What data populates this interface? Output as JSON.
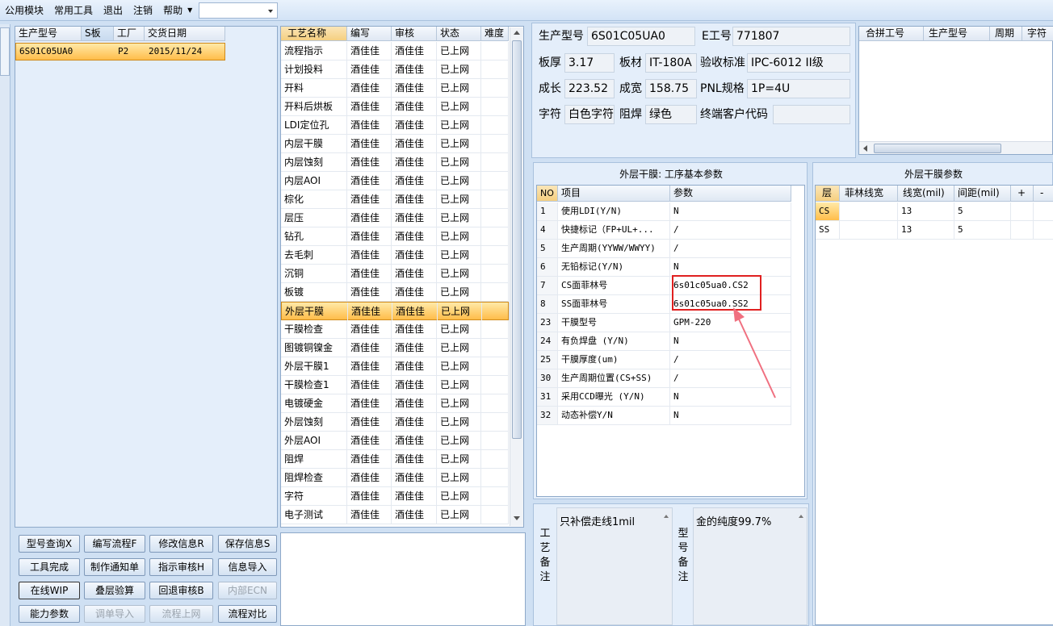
{
  "menu": {
    "items": [
      "公用模块",
      "常用工具",
      "退出",
      "注销",
      "帮助"
    ],
    "combo_value": ""
  },
  "left_grid": {
    "columns": [
      "生产型号",
      "S板",
      "工厂",
      "交货日期"
    ],
    "rows": [
      [
        "6S01C05UA0",
        "",
        "P2",
        "2015/11/24"
      ]
    ]
  },
  "process_grid": {
    "columns": [
      "工艺名称",
      "编写",
      "审核",
      "状态",
      "难度"
    ],
    "selected_index": 14,
    "rows": [
      [
        "流程指示",
        "酒佳佳",
        "酒佳佳",
        "已上网",
        ""
      ],
      [
        "计划投料",
        "酒佳佳",
        "酒佳佳",
        "已上网",
        ""
      ],
      [
        "开料",
        "酒佳佳",
        "酒佳佳",
        "已上网",
        ""
      ],
      [
        "开料后烘板",
        "酒佳佳",
        "酒佳佳",
        "已上网",
        ""
      ],
      [
        "LDI定位孔",
        "酒佳佳",
        "酒佳佳",
        "已上网",
        ""
      ],
      [
        "内层干膜",
        "酒佳佳",
        "酒佳佳",
        "已上网",
        ""
      ],
      [
        "内层蚀刻",
        "酒佳佳",
        "酒佳佳",
        "已上网",
        ""
      ],
      [
        "内层AOI",
        "酒佳佳",
        "酒佳佳",
        "已上网",
        ""
      ],
      [
        "棕化",
        "酒佳佳",
        "酒佳佳",
        "已上网",
        ""
      ],
      [
        "层压",
        "酒佳佳",
        "酒佳佳",
        "已上网",
        ""
      ],
      [
        "钻孔",
        "酒佳佳",
        "酒佳佳",
        "已上网",
        ""
      ],
      [
        "去毛刺",
        "酒佳佳",
        "酒佳佳",
        "已上网",
        ""
      ],
      [
        "沉铜",
        "酒佳佳",
        "酒佳佳",
        "已上网",
        ""
      ],
      [
        "板镀",
        "酒佳佳",
        "酒佳佳",
        "已上网",
        ""
      ],
      [
        "外层干膜",
        "酒佳佳",
        "酒佳佳",
        "已上网",
        ""
      ],
      [
        "干膜检查",
        "酒佳佳",
        "酒佳佳",
        "已上网",
        ""
      ],
      [
        "图镀铜镍金",
        "酒佳佳",
        "酒佳佳",
        "已上网",
        ""
      ],
      [
        "外层干膜1",
        "酒佳佳",
        "酒佳佳",
        "已上网",
        ""
      ],
      [
        "干膜检查1",
        "酒佳佳",
        "酒佳佳",
        "已上网",
        ""
      ],
      [
        "电镀硬金",
        "酒佳佳",
        "酒佳佳",
        "已上网",
        ""
      ],
      [
        "外层蚀刻",
        "酒佳佳",
        "酒佳佳",
        "已上网",
        ""
      ],
      [
        "外层AOI",
        "酒佳佳",
        "酒佳佳",
        "已上网",
        ""
      ],
      [
        "阻焊",
        "酒佳佳",
        "酒佳佳",
        "已上网",
        ""
      ],
      [
        "阻焊检查",
        "酒佳佳",
        "酒佳佳",
        "已上网",
        ""
      ],
      [
        "字符",
        "酒佳佳",
        "酒佳佳",
        "已上网",
        ""
      ],
      [
        "电子测试",
        "酒佳佳",
        "酒佳佳",
        "已上网",
        ""
      ]
    ]
  },
  "buttons": [
    [
      "型号查询X",
      "编写流程F",
      "修改信息R",
      "保存信息S"
    ],
    [
      "工具完成",
      "制作通知单",
      "指示审核H",
      "信息导入"
    ],
    [
      "在线WIP",
      "叠层验算",
      "回退审核B",
      "内部ECN"
    ],
    [
      "能力参数",
      "调单导入",
      "流程上网",
      "流程对比"
    ]
  ],
  "info": {
    "model_label": "生产型号",
    "model": "6S01C05UA0",
    "e_label": "E工号",
    "e_no": "771807",
    "thick_label": "板厚",
    "thick": "3.17",
    "mat_label": "板材",
    "mat": "IT-180A",
    "std_label": "验收标准",
    "std": "IPC-6012 II级",
    "len_label": "成长",
    "len": "223.52",
    "wid_label": "成宽",
    "wid": "158.75",
    "pnl_label": "PNL规格",
    "pnl": "1P=4U",
    "char_label": "字符",
    "char": "白色字符",
    "mask_label": "阻焊",
    "mask": "绿色",
    "cust_label": "终端客户代码",
    "cust": ""
  },
  "combine_grid": {
    "columns": [
      "合拼工号",
      "生产型号",
      "周期",
      "字符"
    ]
  },
  "param_panel": {
    "title": "外层干膜: 工序基本参数",
    "columns": [
      "NO",
      "项目",
      "参数"
    ],
    "rows": [
      [
        "1",
        "使用LDI(Y/N)",
        "N"
      ],
      [
        "4",
        "快捷标记（FP+UL+...",
        "/"
      ],
      [
        "5",
        "生产周期(YYWW/WWYY)",
        "/"
      ],
      [
        "6",
        "无铅标记(Y/N)",
        "N"
      ],
      [
        "7",
        "CS面菲林号",
        "6s01c05ua0.CS2"
      ],
      [
        "8",
        "SS面菲林号",
        "6s01c05ua0.SS2"
      ],
      [
        "23",
        "干膜型号",
        "GPM-220"
      ],
      [
        "24",
        "有负焊盘 (Y/N)",
        "N"
      ],
      [
        "25",
        "干膜厚度(um)",
        "/"
      ],
      [
        "30",
        "生产周期位置(CS+SS)",
        "/"
      ],
      [
        "31",
        "采用CCD曝光 (Y/N)",
        "N"
      ],
      [
        "32",
        "动态补偿Y/N",
        "N"
      ]
    ]
  },
  "film_panel": {
    "title": "外层干膜参数",
    "columns": [
      "层",
      "菲林线宽",
      "线宽(mil)",
      "间距(mil)",
      "+",
      "-"
    ],
    "rows": [
      [
        "CS",
        "",
        "13",
        "5"
      ],
      [
        "SS",
        "",
        "13",
        "5"
      ]
    ]
  },
  "remarks": {
    "process_label": "工艺备注",
    "process_text": "只补偿走线1mil",
    "model_label": "型号备注",
    "model_text": "金的纯度99.7%"
  },
  "colors": {
    "selection": "#ffbd4a",
    "highlight_box": "#e02020",
    "arrow": "#f07080"
  }
}
